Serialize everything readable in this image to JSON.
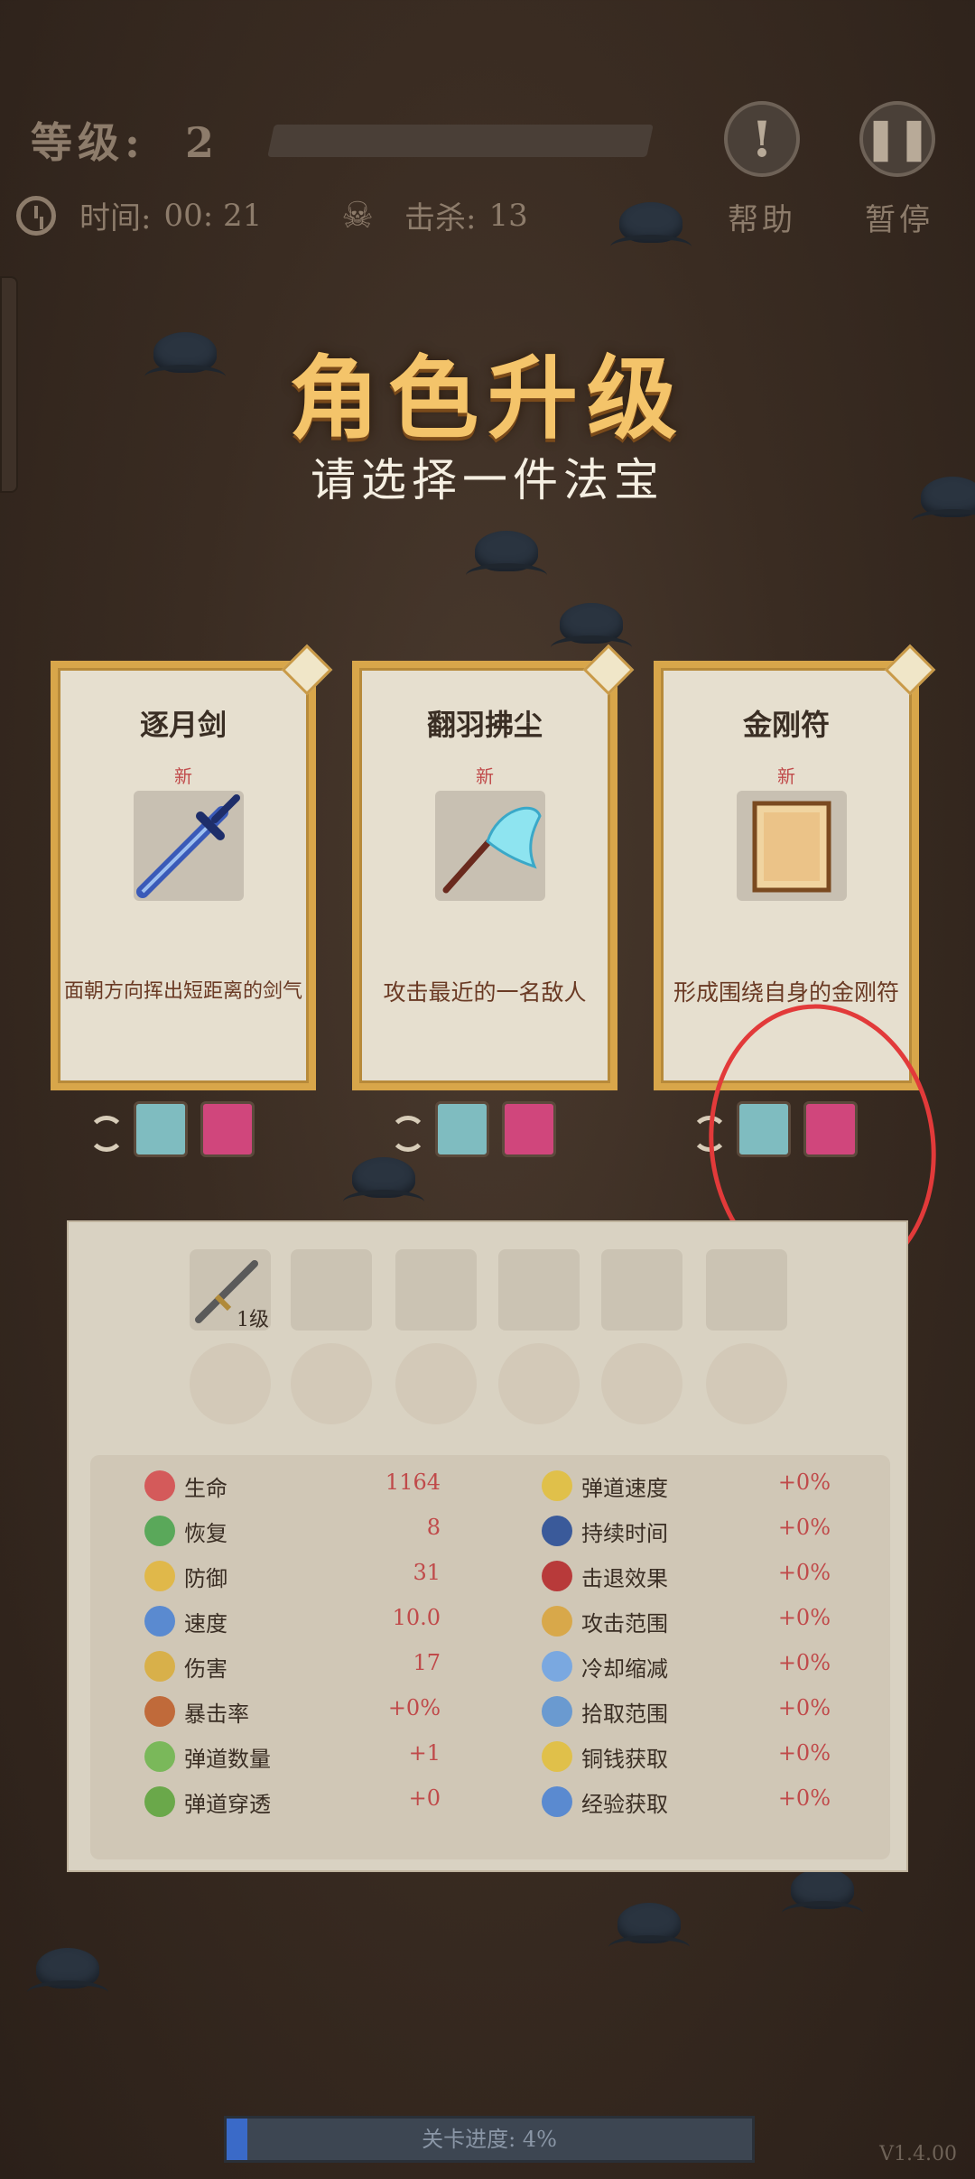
{
  "hud": {
    "level_label": "等级:",
    "level_value": "2",
    "time_label": "时间:",
    "time_value": "00: 21",
    "kill_label": "击杀:",
    "kill_value": "13",
    "help_label": "帮助",
    "pause_label": "暂停"
  },
  "title": "角色升级",
  "subtitle": "请选择一件法宝",
  "cards": [
    {
      "name": "逐月剑",
      "tag": "新",
      "desc": "面朝方向挥出短距离的剑气",
      "icon": "sword-icon"
    },
    {
      "name": "翻羽拂尘",
      "tag": "新",
      "desc": "攻击最近的一名敌人",
      "icon": "whisk-icon"
    },
    {
      "name": "金刚符",
      "tag": "新",
      "desc": "形成围绕自身的金刚符",
      "icon": "talisman-icon"
    }
  ],
  "inventory": {
    "slot1_level": "1级"
  },
  "stats_left": [
    {
      "label": "生命",
      "value": "1164"
    },
    {
      "label": "恢复",
      "value": "8"
    },
    {
      "label": "防御",
      "value": "31"
    },
    {
      "label": "速度",
      "value": "10.0"
    },
    {
      "label": "伤害",
      "value": "17"
    },
    {
      "label": "暴击率",
      "value": "+0%"
    },
    {
      "label": "弹道数量",
      "value": "+1"
    },
    {
      "label": "弹道穿透",
      "value": "+0"
    }
  ],
  "stats_right": [
    {
      "label": "弹道速度",
      "value": "+0%"
    },
    {
      "label": "持续时间",
      "value": "+0%"
    },
    {
      "label": "击退效果",
      "value": "+0%"
    },
    {
      "label": "攻击范围",
      "value": "+0%"
    },
    {
      "label": "冷却缩减",
      "value": "+0%"
    },
    {
      "label": "拾取范围",
      "value": "+0%"
    },
    {
      "label": "铜钱获取",
      "value": "+0%"
    },
    {
      "label": "经验获取",
      "value": "+0%"
    }
  ],
  "progress": {
    "label": "关卡进度: 4%",
    "percent": 4
  },
  "version": "V1.4.00",
  "colors": {
    "card_border": "#d8a64a",
    "title": "#f4c46a",
    "stat_value": "#c04a4a",
    "annotation": "#e23a3a"
  }
}
